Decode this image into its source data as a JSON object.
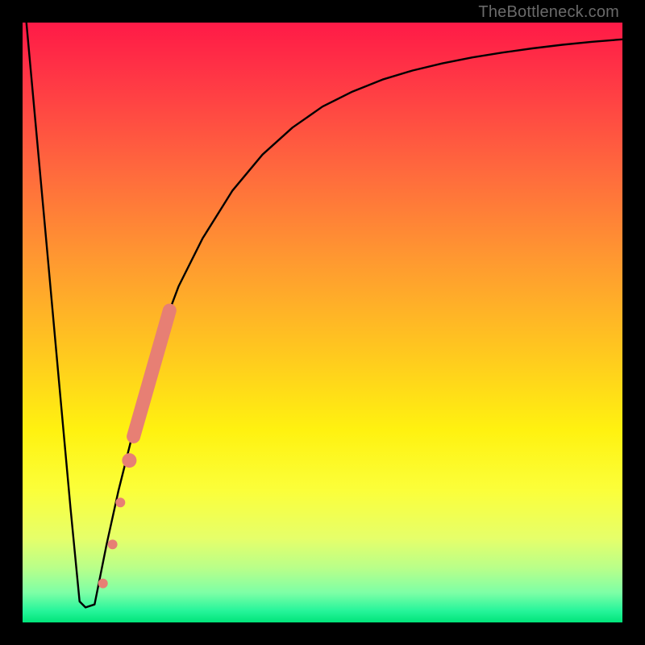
{
  "credit": "TheBottleneck.com",
  "colors": {
    "frame": "#000000",
    "curve": "#000000",
    "dot_fill": "#e77f74",
    "dot_stroke": "#c75f56"
  },
  "chart_data": {
    "type": "line",
    "title": "",
    "xlabel": "",
    "ylabel": "",
    "xlim": [
      0,
      100
    ],
    "ylim": [
      0,
      100
    ],
    "grid": false,
    "series": [
      {
        "name": "curve",
        "x": [
          0,
          2,
          4,
          6,
          8,
          9.5,
          10.5,
          12,
          14,
          16,
          18,
          20,
          23,
          26,
          30,
          35,
          40,
          45,
          50,
          55,
          60,
          65,
          70,
          75,
          80,
          85,
          90,
          95,
          100
        ],
        "y": [
          107,
          85,
          63,
          41,
          19,
          3.5,
          2.5,
          3,
          13,
          22,
          30,
          38,
          48,
          56,
          64,
          72,
          78,
          82.5,
          86,
          88.5,
          90.5,
          92,
          93.2,
          94.2,
          95,
          95.7,
          96.3,
          96.8,
          97.2
        ]
      }
    ],
    "dots": [
      {
        "x": 13.4,
        "y": 6.5,
        "r": 6
      },
      {
        "x": 15.0,
        "y": 13.0,
        "r": 6
      },
      {
        "x": 16.3,
        "y": 20.0,
        "r": 6
      },
      {
        "x": 17.8,
        "y": 27.0,
        "r": 9
      }
    ],
    "thick_segment": {
      "x": [
        18.5,
        24.5
      ],
      "y": [
        31.0,
        52.0
      ]
    }
  }
}
